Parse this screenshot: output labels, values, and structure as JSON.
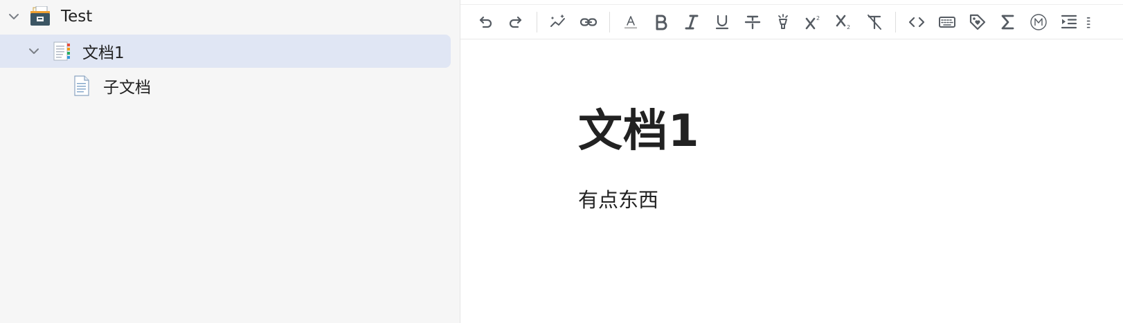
{
  "sidebar": {
    "notebook": {
      "label": "Test",
      "icon": "card-file-box-icon",
      "expanded": true
    },
    "document": {
      "label": "文档1",
      "icon": "document-with-tabs-icon",
      "expanded": true,
      "selected": true
    },
    "subdocument": {
      "label": "子文档",
      "icon": "page-icon"
    }
  },
  "toolbar": {
    "items": [
      {
        "name": "undo",
        "icon": "undo-icon"
      },
      {
        "name": "redo",
        "icon": "redo-icon"
      },
      {
        "name": "magic",
        "icon": "magic-wand-icon"
      },
      {
        "name": "link",
        "icon": "link-icon"
      },
      {
        "name": "font-color",
        "icon": "font-color-icon"
      },
      {
        "name": "bold",
        "icon": "bold-icon"
      },
      {
        "name": "italic",
        "icon": "italic-icon"
      },
      {
        "name": "underline",
        "icon": "underline-icon"
      },
      {
        "name": "strikethrough",
        "icon": "strikethrough-icon"
      },
      {
        "name": "highlight",
        "icon": "highlighter-icon"
      },
      {
        "name": "superscript",
        "icon": "superscript-icon"
      },
      {
        "name": "subscript",
        "icon": "subscript-icon"
      },
      {
        "name": "clear-format",
        "icon": "clear-format-icon"
      },
      {
        "name": "inline-code",
        "icon": "code-icon"
      },
      {
        "name": "keyboard",
        "icon": "keyboard-icon"
      },
      {
        "name": "tag",
        "icon": "tag-icon"
      },
      {
        "name": "math",
        "icon": "sigma-icon"
      },
      {
        "name": "memo",
        "icon": "circled-m-icon"
      },
      {
        "name": "indent",
        "icon": "indent-icon"
      }
    ]
  },
  "document": {
    "title": "文档1",
    "body": "有点东西"
  },
  "colors": {
    "sidebar_bg": "#f6f6f6",
    "selected_row_bg": "#e0e6f4",
    "toolbar_icon": "#555b62",
    "text": "#222222"
  }
}
